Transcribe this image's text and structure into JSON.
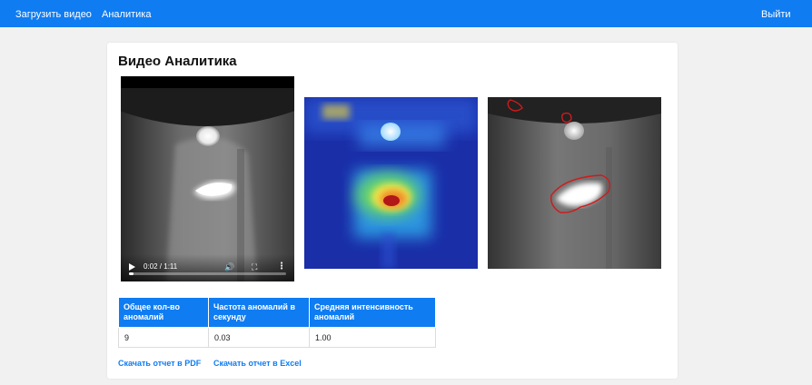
{
  "navbar": {
    "upload_label": "Загрузить видео",
    "analytics_label": "Аналитика",
    "logout_label": "Выйти",
    "color": "#0f7cf2"
  },
  "page": {
    "title": "Видео Аналитика"
  },
  "video": {
    "time": "0:02 / 1:11",
    "progress_fraction": 0.028,
    "icons": [
      "play-icon",
      "volume-icon",
      "fullscreen-icon",
      "more-options-icon"
    ]
  },
  "table": {
    "headers": [
      "Общее кол-во аномалий",
      "Частота аномалий в секунду",
      "Средняя интенсивность аномалий"
    ],
    "rows": [
      [
        "9",
        "0.03",
        "1.00"
      ]
    ]
  },
  "links": {
    "pdf": "Скачать отчет в PDF",
    "excel": "Скачать отчет в Excel"
  }
}
